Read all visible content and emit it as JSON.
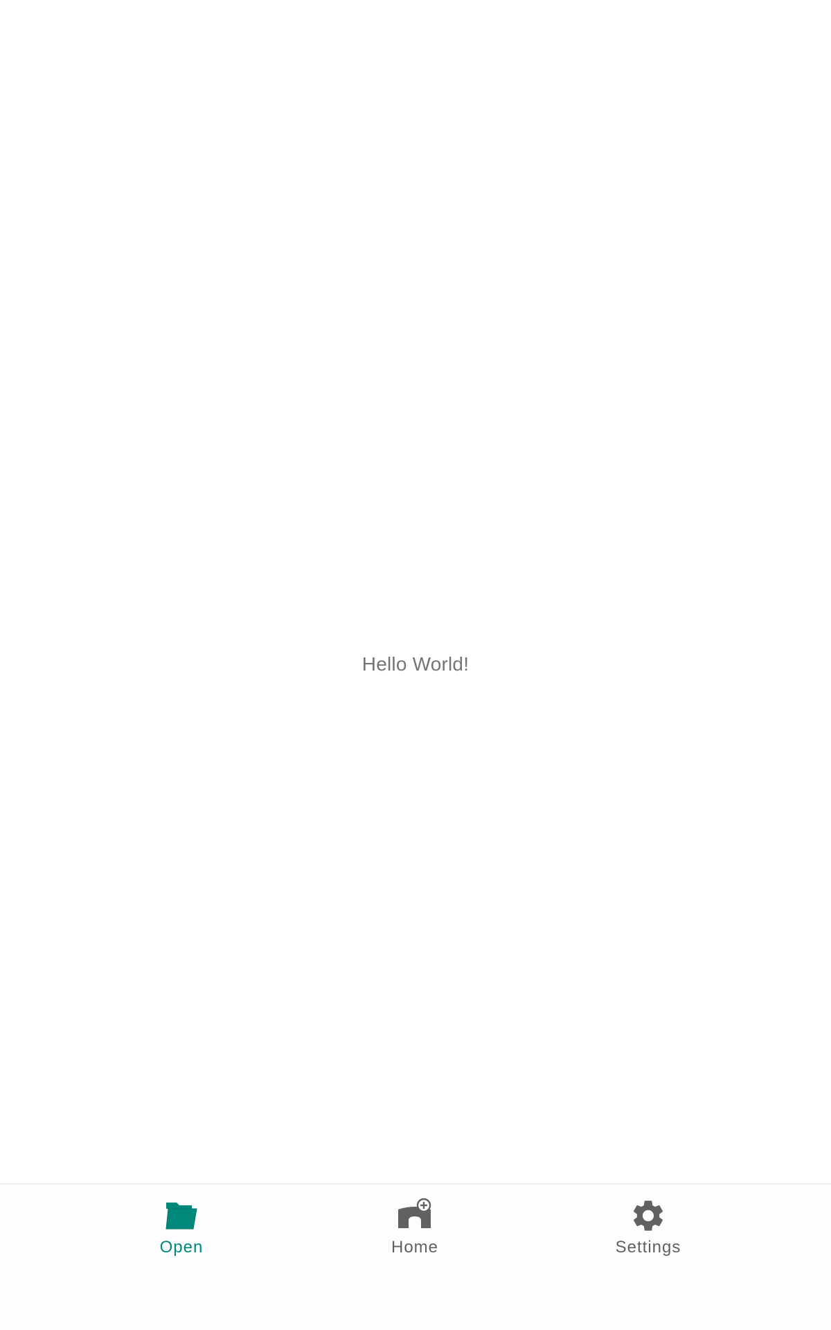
{
  "main": {
    "message": "Hello World!"
  },
  "bottom_nav": {
    "items": [
      {
        "label": "Open",
        "icon": "folder-open-icon",
        "active": true
      },
      {
        "label": "Home",
        "icon": "home-add-icon",
        "active": false
      },
      {
        "label": "Settings",
        "icon": "gear-icon",
        "active": false
      }
    ],
    "colors": {
      "active": "#00897b",
      "inactive": "#616161"
    }
  }
}
